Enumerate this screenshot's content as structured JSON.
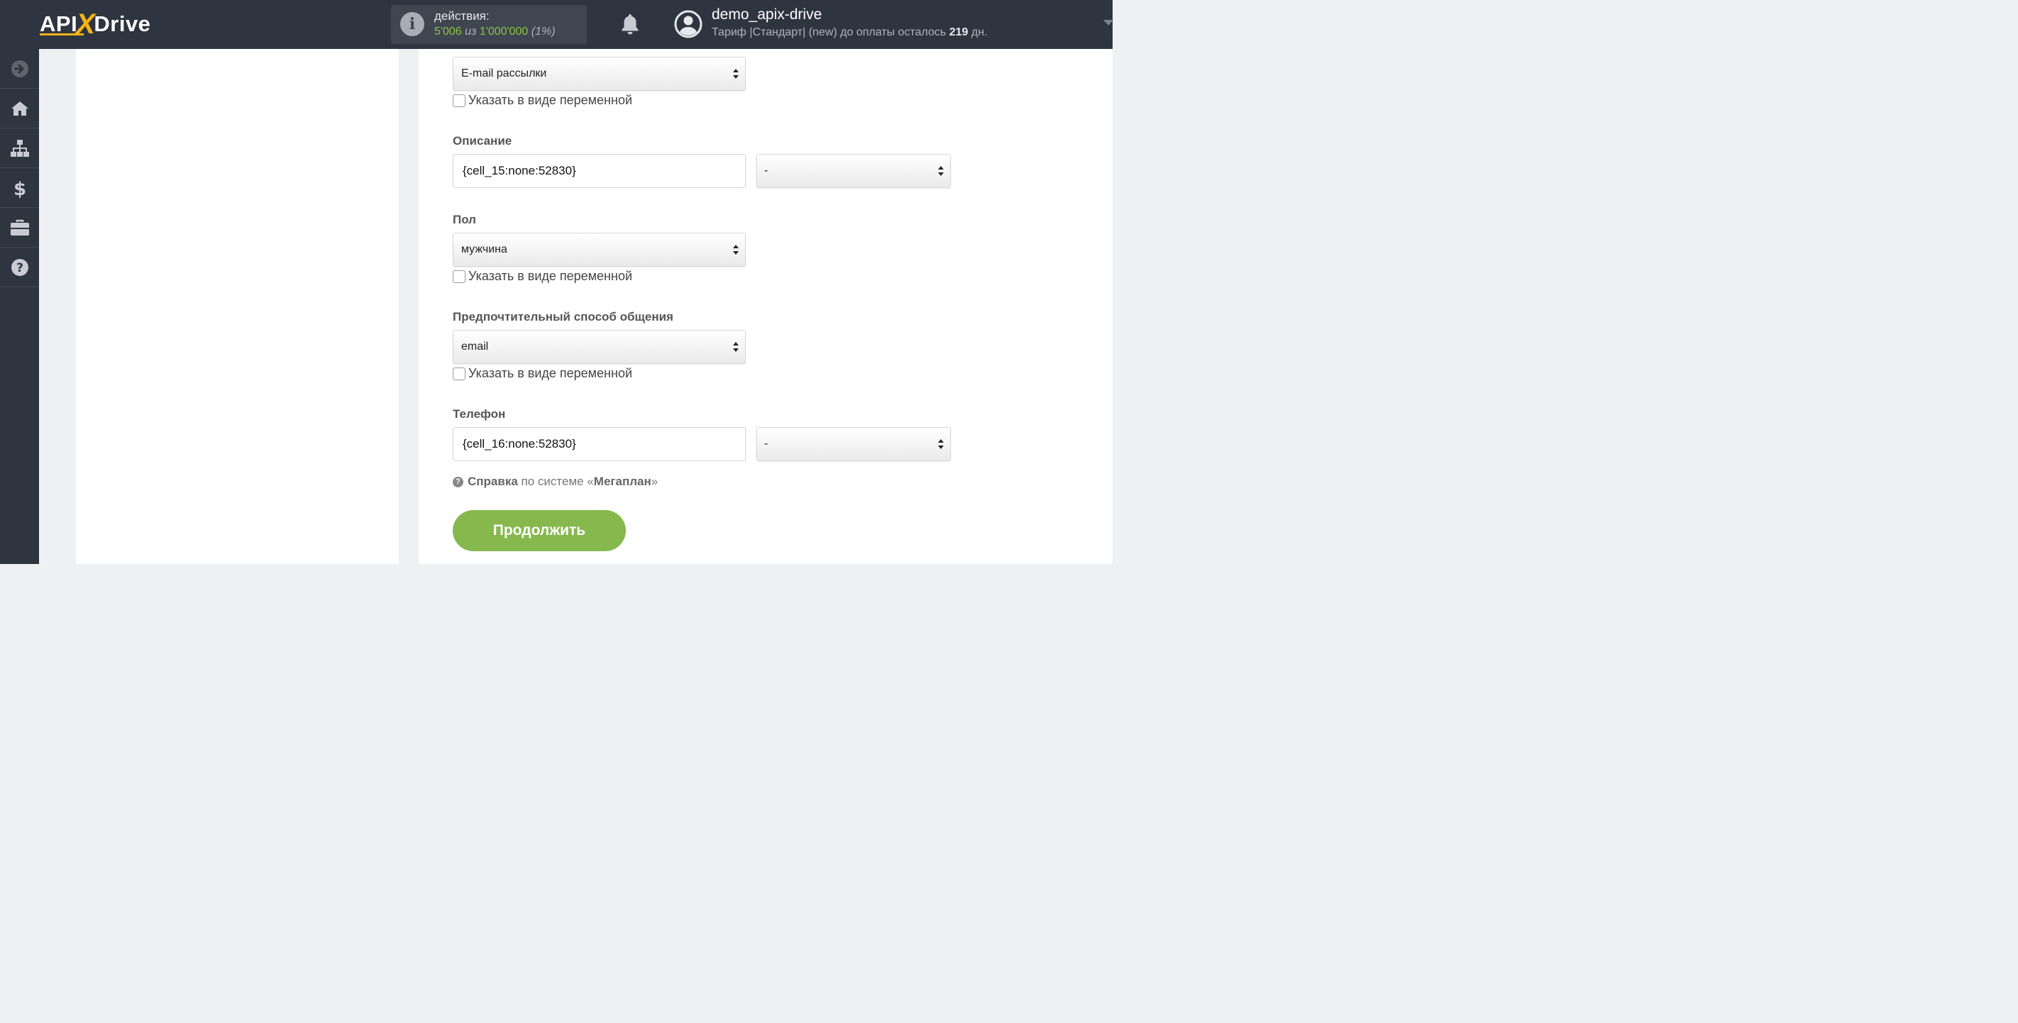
{
  "header": {
    "logo_left": "API",
    "logo_x": "X",
    "logo_right": "Drive",
    "actions_label": "действия:",
    "actions_used": "5'006",
    "actions_of": "из",
    "actions_total": "1'000'000",
    "actions_pct": "(1%)",
    "username": "demo_apix-drive",
    "tariff_text": "Тариф |Стандарт| (new) до оплаты осталось",
    "tariff_days": "219",
    "tariff_days_unit": "дн."
  },
  "sidebar": {
    "items": [
      "arrow-right-icon",
      "home-icon",
      "sitemap-icon",
      "dollar-icon",
      "briefcase-icon",
      "help-icon"
    ]
  },
  "form": {
    "mailing_select": "E-mail рассылки",
    "variable_checkbox_label": "Указать в виде переменной",
    "description_label": "Описание",
    "description_value": "{cell_15:none:52830}",
    "description_select": "-",
    "gender_label": "Пол",
    "gender_select": "мужчина",
    "contact_method_label": "Предпочтительный способ общения",
    "contact_method_select": "email",
    "phone_label": "Телефон",
    "phone_value": "{cell_16:none:52830}",
    "phone_select": "-",
    "help_prefix": "Справка",
    "help_middle": "по системе «",
    "help_system": "Мегаплан",
    "help_suffix": "»",
    "continue_button": "Продолжить"
  },
  "colors": {
    "header_bg": "#2e3540",
    "accent_green": "#86b84e",
    "logo_yellow": "#f6b318"
  }
}
